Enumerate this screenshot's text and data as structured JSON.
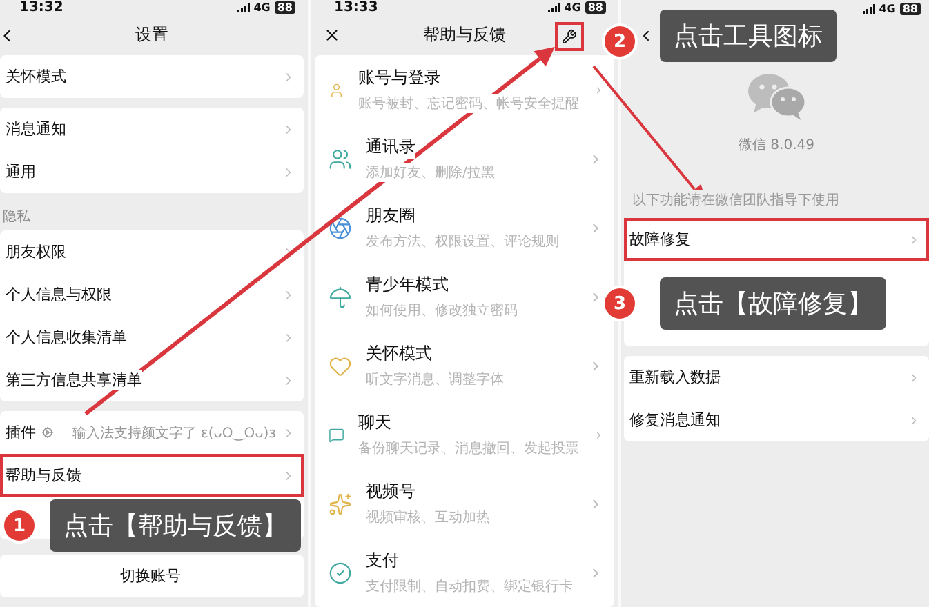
{
  "settings_screen": {
    "status": {
      "time": "13:32",
      "network": "4G",
      "battery": "88"
    },
    "title": "设置",
    "sections": [
      {
        "items": [
          {
            "kind": "row",
            "label": "关怀模式",
            "highlighted": false
          }
        ]
      },
      {
        "items": [
          {
            "kind": "row",
            "label": "消息通知",
            "highlighted": false
          },
          {
            "kind": "row",
            "label": "通用",
            "highlighted": false
          }
        ]
      },
      {
        "heading": "隐私",
        "items": [
          {
            "kind": "row",
            "label": "朋友权限",
            "highlighted": false
          },
          {
            "kind": "row",
            "label": "个人信息与权限",
            "highlighted": false
          },
          {
            "kind": "row",
            "label": "个人信息收集清单",
            "highlighted": false
          },
          {
            "kind": "row",
            "label": "第三方信息共享清单",
            "highlighted": false
          }
        ]
      },
      {
        "items": [
          {
            "kind": "plugin",
            "label": "插件",
            "note": "输入法支持颜文字了 ε(ᴗO‿Oᴗ)з",
            "highlighted": false
          },
          {
            "kind": "row",
            "label": "帮助与反馈",
            "highlighted": true
          },
          {
            "kind": "covered"
          }
        ]
      },
      {
        "items": [
          {
            "kind": "centered",
            "label": "切换账号"
          }
        ]
      }
    ]
  },
  "help_screen": {
    "status": {
      "time": "13:33",
      "network": "4G",
      "battery": "88"
    },
    "title": "帮助与反馈",
    "tool_button": {
      "highlighted": true
    },
    "topics": [
      {
        "title": "账号与登录",
        "description": "账号被封、忘记密码、帐号安全提醒"
      },
      {
        "title": "通讯录",
        "description": "添加好友、删除/拉黑"
      },
      {
        "title": "朋友圈",
        "description": "发布方法、权限设置、评论规则"
      },
      {
        "title": "青少年模式",
        "description": "如何使用、修改独立密码"
      },
      {
        "title": "关怀模式",
        "description": "听文字消息、调整字体"
      },
      {
        "title": "聊天",
        "description": "备份聊天记录、消息撤回、发起投票"
      },
      {
        "title": "视频号",
        "description": "视频审核、互动加热"
      },
      {
        "title": "支付",
        "description": "支付限制、自动扣费、绑定银行卡"
      }
    ]
  },
  "tools_screen": {
    "status": {
      "network": "4G",
      "battery": "88"
    },
    "version": "微信 8.0.49",
    "notice": "以下功能请在微信团队指导下使用",
    "sections": [
      {
        "items": [
          {
            "kind": "row",
            "label": "故障修复",
            "highlighted": true
          },
          {
            "kind": "covered"
          },
          {
            "kind": "covered"
          }
        ]
      },
      {
        "items": [
          {
            "kind": "row",
            "label": "重新载入数据",
            "highlighted": false
          },
          {
            "kind": "row",
            "label": "修复消息通知",
            "highlighted": false
          }
        ]
      }
    ]
  },
  "callouts": [
    {
      "number": "1",
      "text": "点击【帮助与反馈】"
    },
    {
      "number": "2",
      "text": "点击工具图标"
    },
    {
      "number": "3",
      "text": "点击【故障修复】"
    }
  ]
}
